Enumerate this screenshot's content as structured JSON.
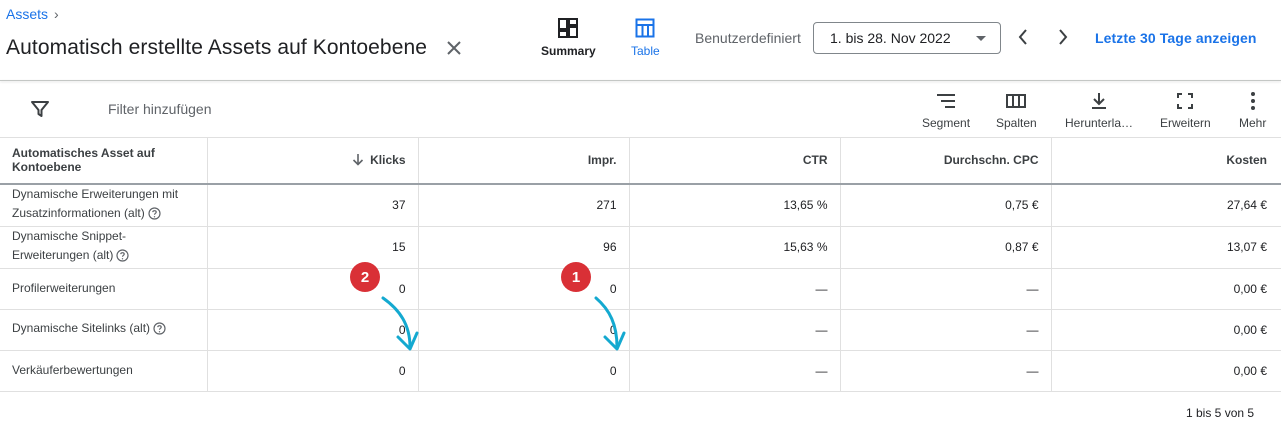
{
  "breadcrumb": {
    "label": "Assets",
    "chevron": "›"
  },
  "header": {
    "title": "Automatisch erstellte Assets auf Kontoebene",
    "views": {
      "summary": "Summary",
      "table": "Table"
    },
    "date_range_label": "Benutzerdefiniert",
    "date_range_value": "1. bis 28. Nov 2022",
    "last30_link": "Letzte 30 Tage anzeigen",
    "accent_color": "#1a73e8"
  },
  "toolbar": {
    "filter_placeholder": "Filter hinzufügen",
    "segment": "Segment",
    "columns": "Spalten",
    "download": "Herunterla…",
    "expand": "Erweitern",
    "more": "Mehr"
  },
  "table": {
    "headers": {
      "asset_line1": "Automatisches Asset auf",
      "asset_line2": "Kontoebene",
      "clicks": "Klicks",
      "impressions": "Impr.",
      "ctr": "CTR",
      "avg_cpc": "Durchschn. CPC",
      "cost": "Kosten"
    },
    "rows": [
      {
        "name_line1": "Dynamische Erweiterungen mit",
        "name_line2": "Zusatzinformationen (alt)",
        "help": true,
        "clicks": "37",
        "impr": "271",
        "ctr": "13,65 %",
        "cpc": "0,75 €",
        "cost": "27,64 €"
      },
      {
        "name_line1": "Dynamische Snippet-",
        "name_line2": "Erweiterungen (alt)",
        "help": true,
        "clicks": "15",
        "impr": "96",
        "ctr": "15,63 %",
        "cpc": "0,87 €",
        "cost": "13,07 €"
      },
      {
        "name_line1": "Profilerweiterungen",
        "name_line2": "",
        "help": false,
        "clicks": "0",
        "impr": "0",
        "ctr": "—",
        "cpc": "—",
        "cost": "0,00 €"
      },
      {
        "name_line1": "Dynamische Sitelinks (alt)",
        "name_line2": "",
        "help": true,
        "clicks": "0",
        "impr": "0",
        "ctr": "—",
        "cpc": "—",
        "cost": "0,00 €"
      },
      {
        "name_line1": "Verkäuferbewertungen",
        "name_line2": "",
        "help": false,
        "clicks": "0",
        "impr": "0",
        "ctr": "—",
        "cpc": "—",
        "cost": "0,00 €"
      }
    ]
  },
  "pagination": "1 bis 5 von 5",
  "annotations": {
    "badge1": "1",
    "badge2": "2",
    "badge_color": "#d93036",
    "arrow_color": "#14a9d0"
  }
}
